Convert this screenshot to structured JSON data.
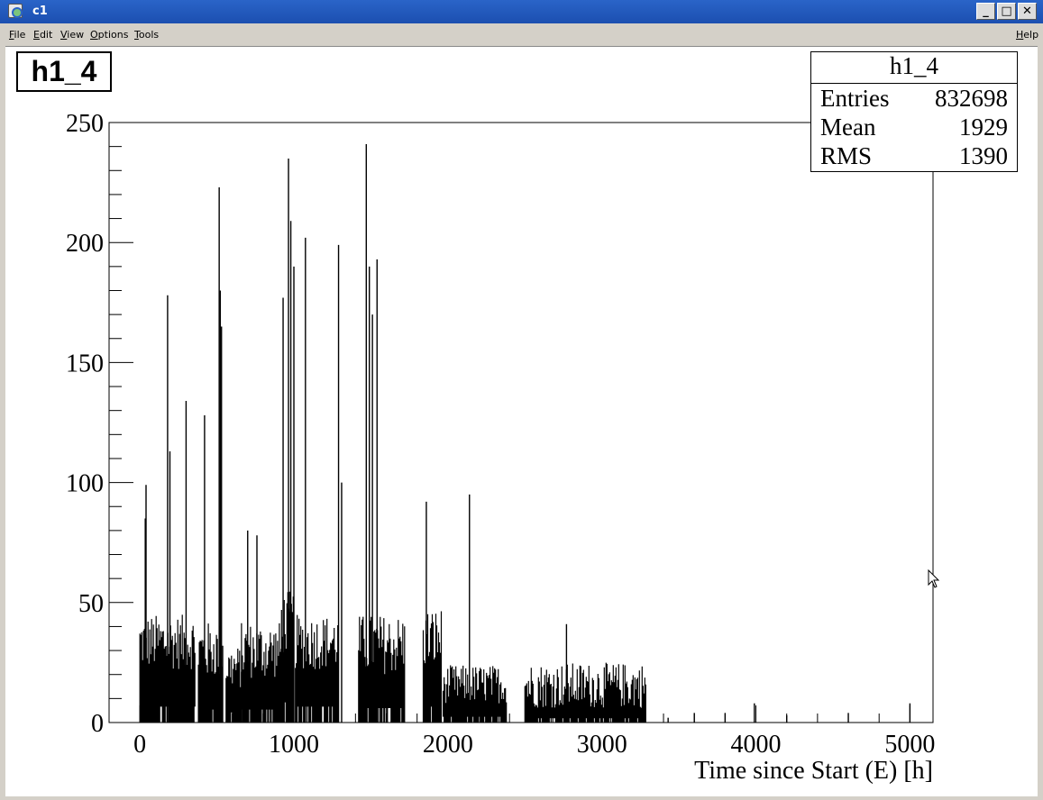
{
  "window": {
    "title": "c1",
    "buttons": {
      "minimize": "_",
      "maximize": "□",
      "close": "✕"
    }
  },
  "menu": {
    "items": [
      "File",
      "Edit",
      "View",
      "Options",
      "Tools"
    ],
    "help": "Help"
  },
  "histogram": {
    "name": "h1_4",
    "stats": {
      "title": "h1_4",
      "rows": [
        {
          "label": "Entries",
          "value": "832698"
        },
        {
          "label": "Mean",
          "value": "1929"
        },
        {
          "label": "RMS",
          "value": "1390"
        }
      ]
    }
  },
  "colors": {
    "titlebar": "#1c4fb0",
    "fill": "#000000",
    "background": "#ffffff"
  },
  "chart_data": {
    "type": "bar",
    "title": "h1_4",
    "xlabel": "Time since Start (E) [h]",
    "ylabel": "",
    "xlim": [
      -200,
      5150
    ],
    "ylim": [
      0,
      250
    ],
    "xticks": [
      0,
      1000,
      2000,
      3000,
      4000,
      5000
    ],
    "yticks": [
      0,
      50,
      100,
      150,
      200,
      250
    ],
    "grid": false,
    "legend": "none",
    "segments": [
      {
        "x": [
          0,
          360
        ],
        "low": 22,
        "high": 45
      },
      {
        "x": [
          380,
          540
        ],
        "low": 18,
        "high": 42
      },
      {
        "x": [
          560,
          660
        ],
        "low": 14,
        "high": 32
      },
      {
        "x": [
          660,
          920
        ],
        "low": 18,
        "high": 42
      },
      {
        "x": [
          920,
          1000
        ],
        "low": 28,
        "high": 55
      },
      {
        "x": [
          1010,
          1290
        ],
        "low": 22,
        "high": 45
      },
      {
        "x": [
          1420,
          1720
        ],
        "low": 20,
        "high": 45
      },
      {
        "x": [
          1840,
          1960
        ],
        "low": 22,
        "high": 48
      },
      {
        "x": [
          1970,
          2380
        ],
        "low": 8,
        "high": 24
      },
      {
        "x": [
          2500,
          3290
        ],
        "low": 6,
        "high": 25
      }
    ],
    "spikes": [
      [
        40,
        99
      ],
      [
        35,
        85
      ],
      [
        180,
        178
      ],
      [
        195,
        113
      ],
      [
        300,
        134
      ],
      [
        420,
        128
      ],
      [
        515,
        223
      ],
      [
        522,
        180
      ],
      [
        530,
        165
      ],
      [
        700,
        80
      ],
      [
        760,
        78
      ],
      [
        930,
        177
      ],
      [
        965,
        235
      ],
      [
        980,
        209
      ],
      [
        1000,
        190
      ],
      [
        1075,
        202
      ],
      [
        1290,
        199
      ],
      [
        1310,
        100
      ],
      [
        1470,
        241
      ],
      [
        1490,
        190
      ],
      [
        1510,
        170
      ],
      [
        1540,
        193
      ],
      [
        1860,
        92
      ],
      [
        2140,
        95
      ],
      [
        2770,
        41
      ],
      [
        3430,
        2
      ],
      [
        3600,
        4
      ],
      [
        3800,
        4
      ],
      [
        3990,
        8
      ],
      [
        4200,
        3
      ],
      [
        4600,
        4
      ],
      [
        5000,
        8
      ]
    ]
  }
}
